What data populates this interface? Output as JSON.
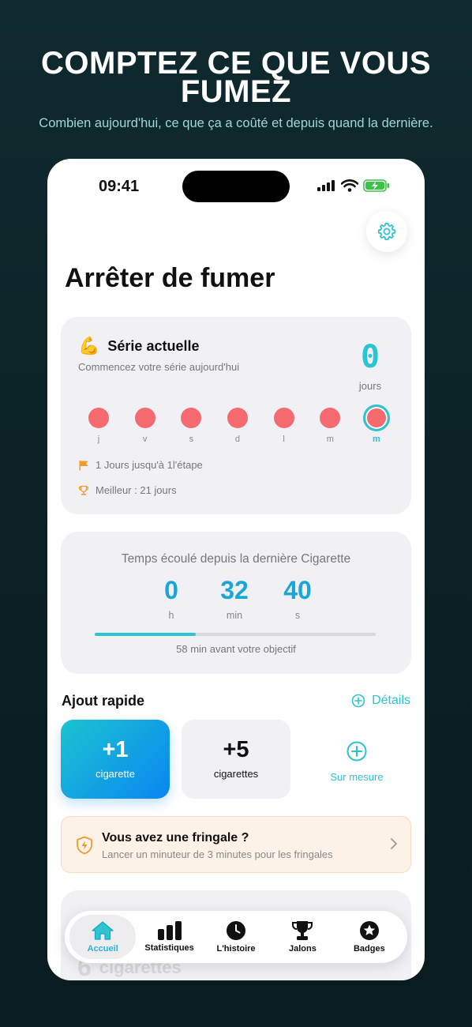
{
  "promo": {
    "title": "COMPTEZ CE QUE VOUS FUMEZ",
    "subtitle": "Combien aujourd'hui, ce que ça a coûté et depuis quand la dernière."
  },
  "status_bar": {
    "time": "09:41",
    "icons": [
      "signal-icon",
      "wifi-icon",
      "battery-charging-icon"
    ]
  },
  "page": {
    "title": "Arrêter de fumer",
    "settings_icon": "gear-icon"
  },
  "streak": {
    "emoji": "💪",
    "title": "Série actuelle",
    "subtitle": "Commencez votre série aujourd'hui",
    "count": "0",
    "unit": "jours",
    "days": [
      {
        "label": "j",
        "today": false
      },
      {
        "label": "v",
        "today": false
      },
      {
        "label": "s",
        "today": false
      },
      {
        "label": "d",
        "today": false
      },
      {
        "label": "l",
        "today": false
      },
      {
        "label": "m",
        "today": false
      },
      {
        "label": "m",
        "today": true
      }
    ],
    "milestone": "1 Jours jusqu'à 1l'étape",
    "best": "Meilleur : 21 jours",
    "colors": {
      "dot": "#f56a6e",
      "accent": "#2bc4cf"
    }
  },
  "timer": {
    "title": "Temps écoulé depuis la dernière Cigarette",
    "hours": "0",
    "hours_unit": "h",
    "minutes": "32",
    "minutes_unit": "min",
    "seconds": "40",
    "seconds_unit": "s",
    "progress": 0.36,
    "goal_text": "58 min avant votre objectif"
  },
  "quick_add": {
    "title": "Ajout rapide",
    "details_label": "Détails",
    "one": {
      "value": "+1",
      "label": "cigarette"
    },
    "five": {
      "value": "+5",
      "label": "cigarettes"
    },
    "custom_label": "Sur mesure"
  },
  "craving": {
    "title": "Vous avez une fringale ?",
    "subtitle": "Lancer un minuteur de 3 minutes pour les fringales"
  },
  "ghost_card": {
    "number": "6",
    "label": "cigarettes"
  },
  "tabbar": {
    "items": [
      {
        "label": "Accueil",
        "icon": "house-icon",
        "active": true
      },
      {
        "label": "Statistiques",
        "icon": "bar-chart-icon",
        "active": false
      },
      {
        "label": "L'histoire",
        "icon": "clock-icon",
        "active": false
      },
      {
        "label": "Jalons",
        "icon": "trophy-icon",
        "active": false
      },
      {
        "label": "Badges",
        "icon": "star-badge-icon",
        "active": false
      }
    ]
  }
}
